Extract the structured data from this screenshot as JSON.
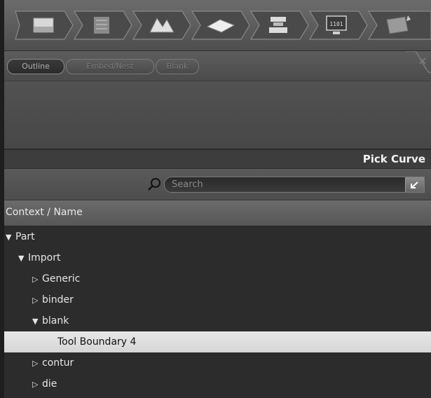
{
  "workflow": {
    "steps": [
      {
        "icon": "sheet-icon"
      },
      {
        "icon": "layers-icon"
      },
      {
        "icon": "die-surface-icon"
      },
      {
        "icon": "blank-plate-icon"
      },
      {
        "icon": "press-icon"
      },
      {
        "icon": "monitor-binary-icon",
        "label": "1101"
      },
      {
        "icon": "results-icon"
      }
    ]
  },
  "tabs": [
    {
      "label": "Outline",
      "active": true
    },
    {
      "label": "Embed/Nest",
      "active": false
    },
    {
      "label": "Blank",
      "active": false
    }
  ],
  "panel": {
    "title": "Pick Curve"
  },
  "search": {
    "placeholder": "Search"
  },
  "tree": {
    "column_header": "Context / Name",
    "rows": [
      {
        "label": "Part",
        "expand": "open",
        "level": 0
      },
      {
        "label": "Import",
        "expand": "open",
        "level": 1
      },
      {
        "label": "Generic",
        "expand": "closed",
        "level": 2
      },
      {
        "label": "binder",
        "expand": "closed",
        "level": 2
      },
      {
        "label": "blank",
        "expand": "open",
        "level": 2
      },
      {
        "label": "Tool Boundary 4",
        "expand": "none",
        "level": 3,
        "selected": true
      },
      {
        "label": "contur",
        "expand": "closed",
        "level": 2
      },
      {
        "label": "die",
        "expand": "closed",
        "level": 2
      }
    ]
  },
  "colors": {
    "background": "#2c2c2c",
    "selected_row": "#dedede",
    "toolbar": "#5e5e5e"
  }
}
